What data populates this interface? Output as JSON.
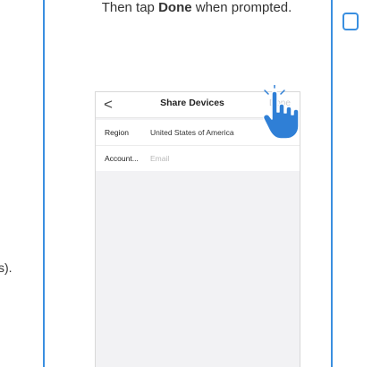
{
  "left_fragment": "s).",
  "instruction": {
    "before": "Then tap ",
    "emphasis": "Done",
    "after": " when prompted."
  },
  "screen": {
    "back_icon": "<",
    "title": "Share Devices",
    "done_label": "Done",
    "rows": [
      {
        "label": "Region",
        "value": "United States of America"
      },
      {
        "label": "Account...",
        "placeholder": "Email"
      }
    ]
  },
  "colors": {
    "guide_blue": "#3a8fe0",
    "hand_blue": "#2f7fd6",
    "done_disabled": "#c9cbd0"
  },
  "icons": [
    "back-chevron-icon",
    "tap-hand-icon",
    "badge-icon"
  ]
}
